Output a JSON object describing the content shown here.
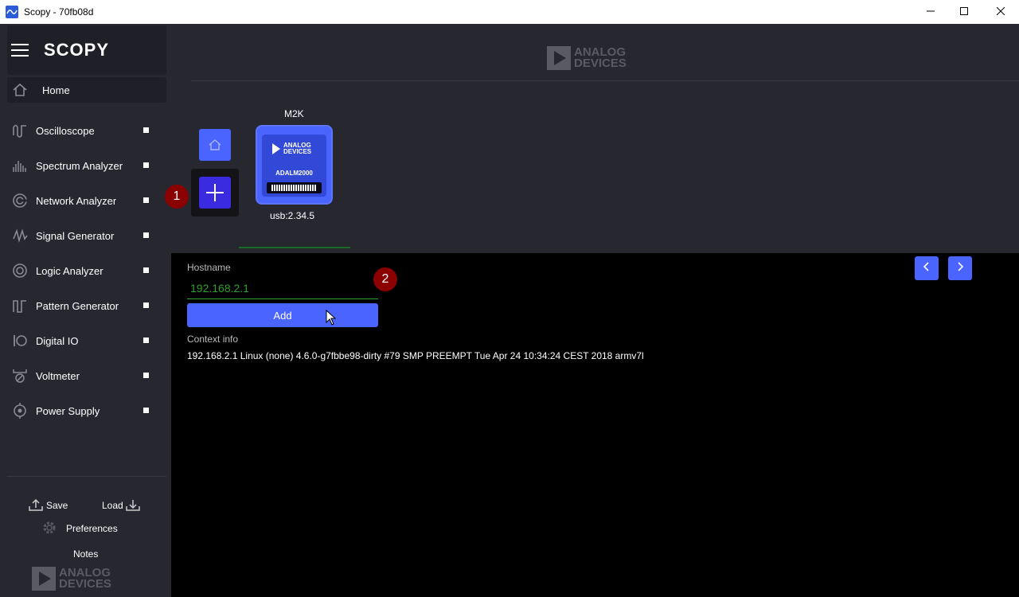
{
  "window": {
    "title": "Scopy - 70fb08d",
    "minimize_icon": "minimize-icon",
    "maximize_icon": "maximize-icon",
    "close_icon": "close-icon"
  },
  "sidebar": {
    "logo": "SCOPY",
    "home_label": "Home",
    "tools": [
      {
        "label": "Oscilloscope",
        "icon": "oscilloscope-icon"
      },
      {
        "label": "Spectrum Analyzer",
        "icon": "spectrum-analyzer-icon"
      },
      {
        "label": "Network Analyzer",
        "icon": "network-analyzer-icon"
      },
      {
        "label": "Signal Generator",
        "icon": "signal-generator-icon"
      },
      {
        "label": "Logic Analyzer",
        "icon": "logic-analyzer-icon"
      },
      {
        "label": "Pattern Generator",
        "icon": "pattern-generator-icon"
      },
      {
        "label": "Digital IO",
        "icon": "digital-io-icon"
      },
      {
        "label": "Voltmeter",
        "icon": "voltmeter-icon"
      },
      {
        "label": "Power Supply",
        "icon": "power-supply-icon"
      }
    ],
    "save_label": "Save",
    "load_label": "Load",
    "preferences_label": "Preferences",
    "notes_label": "Notes",
    "brand_line1": "ANALOG",
    "brand_line2": "DEVICES"
  },
  "header": {
    "brand_line1": "ANALOG",
    "brand_line2": "DEVICES"
  },
  "device": {
    "title": "M2K",
    "card_brand_line1": "ANALOG",
    "card_brand_line2": "DEVICES",
    "card_model": "ADALM2000",
    "uri": "usb:2.34.5"
  },
  "badges": {
    "first": "1",
    "second": "2"
  },
  "connect": {
    "hostname_label": "Hostname",
    "hostname_value": "192.168.2.1",
    "add_label": "Add",
    "context_label": "Context info",
    "context_text": "192.168.2.1 Linux (none) 4.6.0-g7fbbe98-dirty #79 SMP PREEMPT Tue Apr 24 10:34:24 CEST 2018 armv7l"
  },
  "colors": {
    "accent": "#4a64ff",
    "sidebar_bg": "#272730",
    "panel_bg": "#000000",
    "input_green": "#2ea02e",
    "badge_red": "#8b0000"
  }
}
